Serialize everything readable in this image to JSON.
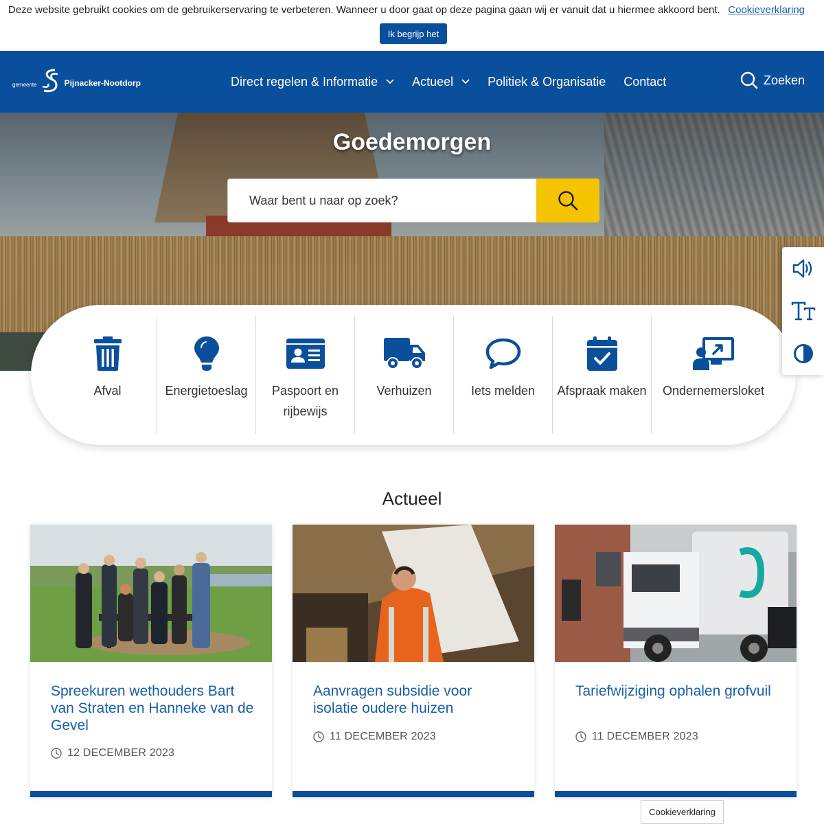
{
  "cookie_bar": {
    "message": "Deze website gebruikt cookies om de gebruikerservaring te verbeteren. Wanneer u door gaat op deze pagina gaan wij er vanuit dat u hiermee akkoord bent.",
    "link_label": "Cookieverklaring",
    "accept_label": "Ik begrijp het"
  },
  "header": {
    "logo_small": "gemeente",
    "logo_name": "Pijnacker-Nootdorp",
    "nav": [
      {
        "label": "Direct regelen & Informatie",
        "icon": "chevron-down-icon"
      },
      {
        "label": "Actueel",
        "icon": "chevron-down-icon"
      },
      {
        "label": "Politiek & Organisatie"
      },
      {
        "label": "Contact"
      }
    ],
    "search_label": "Zoeken"
  },
  "hero": {
    "greeting": "Goedemorgen",
    "search_placeholder": "Waar bent u naar op zoek?"
  },
  "tiles": [
    {
      "label": "Afval",
      "icon": "trash-icon"
    },
    {
      "label": "Energietoeslag",
      "icon": "lightbulb-icon"
    },
    {
      "label": "Paspoort en rijbewijs",
      "icon": "id-card-icon"
    },
    {
      "label": "Verhuizen",
      "icon": "truck-icon"
    },
    {
      "label": "Iets melden",
      "icon": "speech-bubble-icon"
    },
    {
      "label": "Afspraak maken",
      "icon": "calendar-check-icon"
    },
    {
      "label": "Ondernemersloket",
      "icon": "business-presentation-icon"
    }
  ],
  "accessibility": [
    {
      "icon": "speaker-icon"
    },
    {
      "icon": "text-size-icon"
    },
    {
      "icon": "contrast-icon"
    }
  ],
  "news": {
    "title": "Actueel",
    "items": [
      {
        "title": "Spreekuren wethouders Bart van Straten en Hanneke van de Gevel",
        "date": "12 DECEMBER 2023"
      },
      {
        "title": "Aanvragen subsidie voor isolatie oudere huizen",
        "date": "11 DECEMBER 2023"
      },
      {
        "title": "Tariefwijziging ophalen grofvuil",
        "date": "11 DECEMBER 2023"
      }
    ]
  },
  "cookie_float": "Cookieverklaring",
  "colors": {
    "brand_blue": "#0a4f9c",
    "accent_yellow": "#f5c400",
    "link_blue": "#1a5ea8"
  }
}
